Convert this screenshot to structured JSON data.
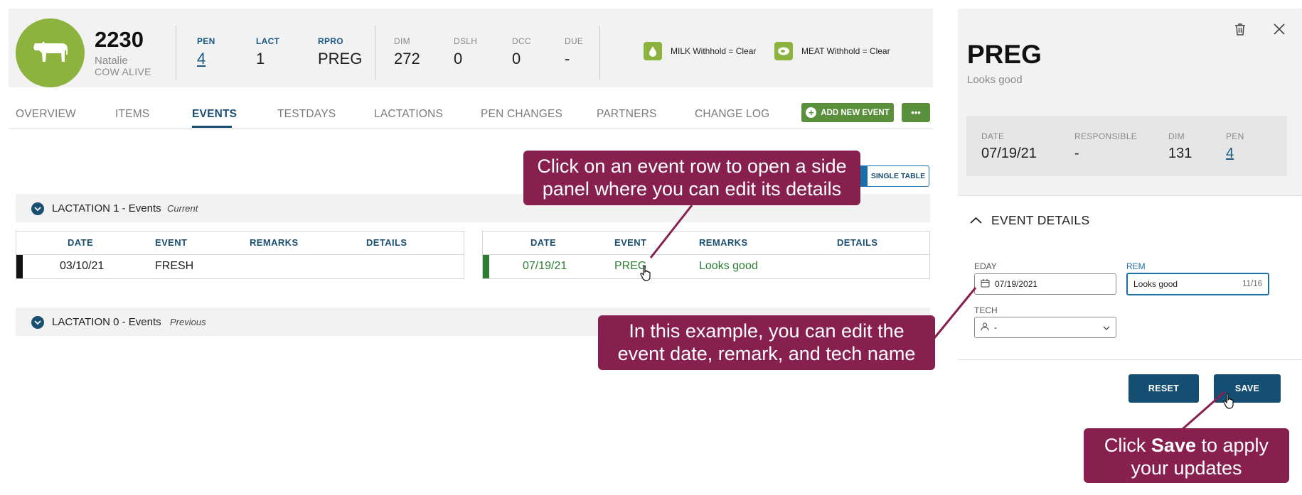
{
  "animal": {
    "id": "2230",
    "name": "Natalie",
    "status": "COW ALIVE",
    "icon": "cow-icon",
    "stats": [
      {
        "label": "PEN",
        "value": "4"
      },
      {
        "label": "LACT",
        "value": "1"
      },
      {
        "label": "RPRO",
        "value": "PREG"
      },
      {
        "label": "DIM",
        "value": "272"
      },
      {
        "label": "DSLH",
        "value": "0"
      },
      {
        "label": "DCC",
        "value": "0"
      },
      {
        "label": "DUE",
        "value": "-"
      }
    ],
    "withhold": [
      {
        "icon": "milk-drop-icon",
        "text": "MILK Withhold = Clear"
      },
      {
        "icon": "meat-icon",
        "text": "MEAT Withhold = Clear"
      }
    ]
  },
  "tabs": [
    "OVERVIEW",
    "ITEMS",
    "EVENTS",
    "TESTDAYS",
    "LACTATIONS",
    "PEN CHANGES",
    "PARTNERS",
    "CHANGE LOG"
  ],
  "active_tab": "EVENTS",
  "toolbar": {
    "add_event": "ADD NEW EVENT",
    "more": "•••"
  },
  "view_toggle": {
    "single": "SINGLE TABLE"
  },
  "lactations": [
    {
      "title": "LACTATION 1 - Events",
      "tag": "Current",
      "columns": [
        "DATE",
        "EVENT",
        "REMARKS",
        "DETAILS"
      ],
      "left_row": {
        "date": "03/10/21",
        "event": "FRESH",
        "remarks": "",
        "details": ""
      },
      "right_row": {
        "date": "07/19/21",
        "event": "PREG",
        "remarks": "Looks good",
        "details": ""
      }
    },
    {
      "title": "LACTATION 0 - Events",
      "tag": "Previous"
    }
  ],
  "panel": {
    "title": "PREG",
    "subtitle": "Looks good",
    "info": [
      {
        "label": "DATE",
        "value": "07/19/21"
      },
      {
        "label": "RESPONSIBLE",
        "value": "-"
      },
      {
        "label": "DIM",
        "value": "131"
      },
      {
        "label": "PEN",
        "value": "4"
      }
    ],
    "section": "EVENT DETAILS",
    "fields": {
      "eday": {
        "label": "EDAY",
        "value": "07/19/2021"
      },
      "rem": {
        "label": "REM",
        "value": "Looks good",
        "counter": "11/16"
      },
      "tech": {
        "label": "TECH",
        "value": "-"
      }
    },
    "reset": "RESET",
    "save": "SAVE"
  },
  "callouts": {
    "row": "Click on an event row to open a side panel where you can edit its details",
    "example": "In this example, you can edit the event date, remark, and tech name",
    "save_pre": "Click ",
    "save_bold": "Save",
    "save_post": " to apply your updates"
  },
  "colors": {
    "accent": "#1b4f72",
    "brand_green": "#8db33f",
    "callout": "#87204f",
    "row_green": "#2e7d32"
  }
}
